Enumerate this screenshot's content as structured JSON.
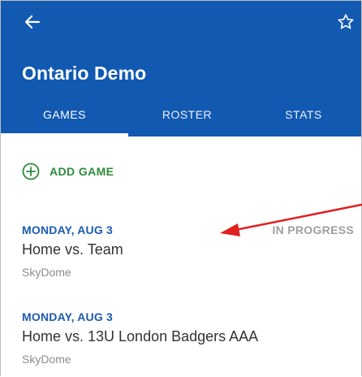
{
  "header": {
    "title": "Ontario Demo",
    "back_icon": "arrow-left-icon",
    "favorite_icon": "star-outline-icon",
    "background_color": "#1259b2"
  },
  "tabs": [
    {
      "label": "GAMES",
      "selected": true
    },
    {
      "label": "ROSTER",
      "selected": false
    },
    {
      "label": "STATS",
      "selected": false
    }
  ],
  "add_game": {
    "label": "ADD GAME",
    "icon": "plus-circle-icon",
    "color": "#2e8b3a"
  },
  "games": [
    {
      "date": "MONDAY, AUG 3",
      "status": "IN PROGRESS",
      "matchup": "Home vs. Team",
      "venue": "SkyDome"
    },
    {
      "date": "MONDAY, AUG 3",
      "status": "",
      "matchup": "Home vs. 13U London Badgers AAA",
      "venue": "SkyDome"
    }
  ],
  "annotation": {
    "arrow_color": "#e02020"
  }
}
